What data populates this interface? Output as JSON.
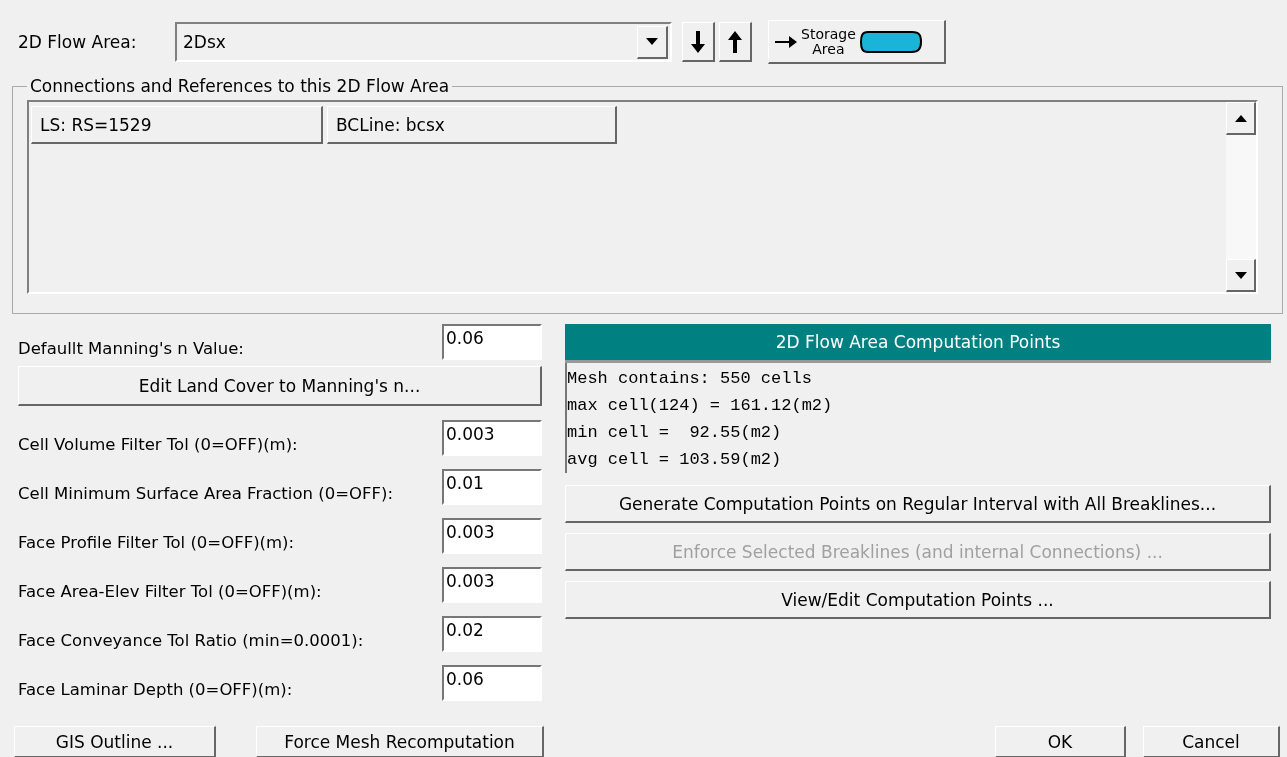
{
  "flow_area": {
    "label": "2D Flow Area:",
    "value": "2Dsx",
    "storage_button": {
      "line_1": "Storage",
      "line_2": "Area"
    }
  },
  "connections": {
    "title": "Connections and References to this 2D Flow Area",
    "items": [
      "LS: RS=1529",
      "BCLine: bcsx"
    ]
  },
  "manning": {
    "label": "Defaullt Manning's n Value:",
    "value": "0.06",
    "edit_button": "Edit Land Cover to Manning's n..."
  },
  "parameters": [
    {
      "label": "Cell Volume Filter Tol (0=OFF)(m):",
      "value": "0.003"
    },
    {
      "label": "Cell Minimum Surface Area Fraction (0=OFF):",
      "value": "0.01"
    },
    {
      "label": "Face Profile Filter Tol (0=OFF)(m):",
      "value": "0.003"
    },
    {
      "label": "Face Area-Elev Filter Tol (0=OFF)(m):",
      "value": "0.003"
    },
    {
      "label": "Face Conveyance Tol Ratio (min=0.0001):",
      "value": "0.02"
    },
    {
      "label": "Face Laminar Depth (0=OFF)(m):",
      "value": "0.06"
    }
  ],
  "computation_points": {
    "title": "2D Flow Area Computation Points",
    "mesh_info": [
      "Mesh contains: 550 cells",
      "max cell(124) = 161.12(m2)",
      "min cell =  92.55(m2)",
      "avg cell = 103.59(m2)"
    ],
    "buttons": [
      {
        "label": "Generate Computation Points on Regular Interval with All Breaklines...",
        "disabled": false
      },
      {
        "label": "Enforce Selected Breaklines (and internal Connections) ...",
        "disabled": true
      },
      {
        "label": "View/Edit Computation Points ...",
        "disabled": false
      }
    ]
  },
  "bottom_buttons": {
    "left": [
      "GIS Outline ...",
      "Force Mesh Recomputation"
    ],
    "right": [
      "OK",
      "Cancel"
    ]
  }
}
